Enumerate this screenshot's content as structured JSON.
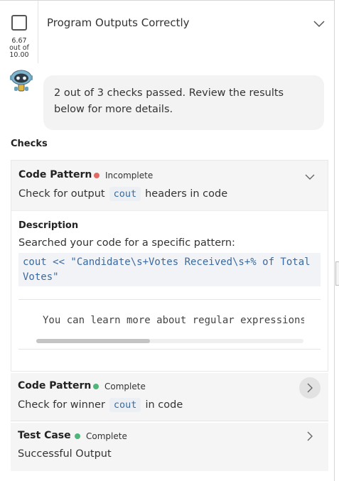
{
  "criterion": {
    "title": "Program Outputs Correctly",
    "score_line1": "6.67",
    "score_line2": "out of",
    "score_line3": "10.00"
  },
  "bot": {
    "message": "2 out of 3 checks passed. Review the results below for more details."
  },
  "checks_heading": "Checks",
  "checks": [
    {
      "type": "Code Pattern",
      "status": "Incomplete",
      "status_color": "#e26a64",
      "desc_before": "Check for output",
      "code": "cout",
      "desc_after": "headers in code",
      "description_heading": "Description",
      "searched_text": "Searched your code for a specific pattern:",
      "pattern": "cout << \"Candidate\\s+Votes Received\\s+% of Total Votes\"",
      "learn_more": "You can learn more about regular expressions"
    },
    {
      "type": "Code Pattern",
      "status": "Complete",
      "status_color": "#4fb57a",
      "desc_before": "Check for winner",
      "code": "cout",
      "desc_after": "in code"
    },
    {
      "type": "Test Case",
      "status": "Complete",
      "status_color": "#4fb57a",
      "desc": "Successful Output"
    }
  ]
}
